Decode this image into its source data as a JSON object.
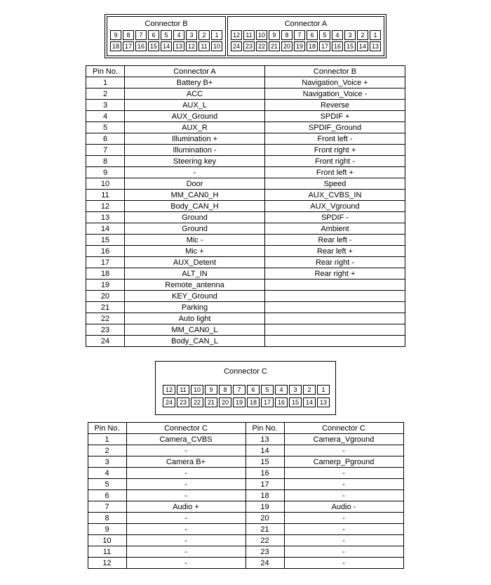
{
  "connectors": {
    "A": {
      "label": "Connector A",
      "pins_row1": [
        12,
        11,
        10,
        9,
        8,
        7,
        6,
        5,
        4,
        3,
        2,
        1
      ],
      "pins_row2": [
        24,
        23,
        22,
        21,
        20,
        19,
        18,
        17,
        16,
        15,
        14,
        13
      ]
    },
    "B": {
      "label": "Connector B",
      "pins_row1": [
        9,
        8,
        7,
        6,
        5,
        4,
        3,
        2,
        1
      ],
      "pins_row2": [
        18,
        17,
        16,
        15,
        14,
        13,
        12,
        11,
        10
      ]
    },
    "C": {
      "label": "Connector C",
      "pins_row1": [
        12,
        11,
        10,
        9,
        8,
        7,
        6,
        5,
        4,
        3,
        2,
        1
      ],
      "pins_row2": [
        24,
        23,
        22,
        21,
        20,
        19,
        18,
        17,
        16,
        15,
        14,
        13
      ]
    }
  },
  "table1": {
    "headers": [
      "Pin No.",
      "Connector A",
      "Connector B"
    ],
    "rows": [
      {
        "pin": 1,
        "a": "Battery B+",
        "b": "Navigation_Voice +"
      },
      {
        "pin": 2,
        "a": "ACC",
        "b": "Navigation_Voice -"
      },
      {
        "pin": 3,
        "a": "AUX_L",
        "b": "Reverse"
      },
      {
        "pin": 4,
        "a": "AUX_Ground",
        "b": "SPDIF +"
      },
      {
        "pin": 5,
        "a": "AUX_R",
        "b": "SPDIF_Ground"
      },
      {
        "pin": 6,
        "a": "Illumination +",
        "b": "Front left -"
      },
      {
        "pin": 7,
        "a": "Illumination -",
        "b": "Front right +"
      },
      {
        "pin": 8,
        "a": "Steering key",
        "b": "Front right -"
      },
      {
        "pin": 9,
        "a": "-",
        "b": "Front left +"
      },
      {
        "pin": 10,
        "a": "Door",
        "b": "Speed"
      },
      {
        "pin": 11,
        "a": "MM_CAN0_H",
        "b": "AUX_CVBS_IN"
      },
      {
        "pin": 12,
        "a": "Body_CAN_H",
        "b": "AUX_Vground"
      },
      {
        "pin": 13,
        "a": "Ground",
        "b": "SPDIF -"
      },
      {
        "pin": 14,
        "a": "Ground",
        "b": "Ambient"
      },
      {
        "pin": 15,
        "a": "Mic -",
        "b": "Rear left -"
      },
      {
        "pin": 16,
        "a": "Mic +",
        "b": "Rear left +"
      },
      {
        "pin": 17,
        "a": "AUX_Detent",
        "b": "Rear right -"
      },
      {
        "pin": 18,
        "a": "ALT_IN",
        "b": "Rear right +"
      },
      {
        "pin": 19,
        "a": "Remote_antenna",
        "b": ""
      },
      {
        "pin": 20,
        "a": "KEY_Ground",
        "b": ""
      },
      {
        "pin": 21,
        "a": "Parking",
        "b": ""
      },
      {
        "pin": 22,
        "a": "Auto light",
        "b": ""
      },
      {
        "pin": 23,
        "a": "MM_CAN0_L",
        "b": ""
      },
      {
        "pin": 24,
        "a": "Body_CAN_L",
        "b": ""
      }
    ]
  },
  "table2": {
    "headers": [
      "Pin No.",
      "Connector C",
      "Pin No.",
      "Connector C"
    ],
    "rows": [
      {
        "p1": 1,
        "c1": "Camera_CVBS",
        "p2": 13,
        "c2": "Camera_Vground"
      },
      {
        "p1": 2,
        "c1": "-",
        "p2": 14,
        "c2": "-"
      },
      {
        "p1": 3,
        "c1": "Camera B+",
        "p2": 15,
        "c2": "Camerp_Pground"
      },
      {
        "p1": 4,
        "c1": "-",
        "p2": 16,
        "c2": "-"
      },
      {
        "p1": 5,
        "c1": "-",
        "p2": 17,
        "c2": "-"
      },
      {
        "p1": 6,
        "c1": "-",
        "p2": 18,
        "c2": "-"
      },
      {
        "p1": 7,
        "c1": "Audio +",
        "p2": 19,
        "c2": "Audio -"
      },
      {
        "p1": 8,
        "c1": "-",
        "p2": 20,
        "c2": "-"
      },
      {
        "p1": 9,
        "c1": "-",
        "p2": 21,
        "c2": "-"
      },
      {
        "p1": 10,
        "c1": "-",
        "p2": 22,
        "c2": "-"
      },
      {
        "p1": 11,
        "c1": "-",
        "p2": 23,
        "c2": "-"
      },
      {
        "p1": 12,
        "c1": "-",
        "p2": 24,
        "c2": "-"
      }
    ]
  }
}
